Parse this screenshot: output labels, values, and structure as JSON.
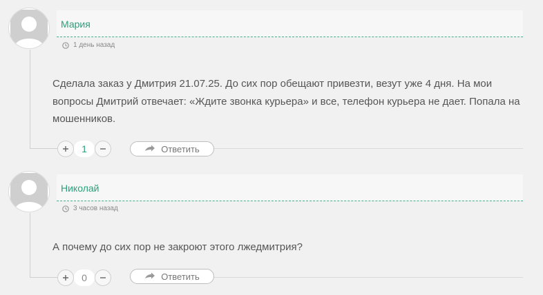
{
  "comments": [
    {
      "author": "Мария",
      "date": "1 день назад",
      "text": "Сделала заказ у Дмитрия 21.07.25. До сих пор обещают привезти, везут уже 4 дня. На мои вопросы Дмитрий отвечает: «Ждите звонка курьера» и все, телефон курьера не дает. Попала на мошенников.",
      "votes": "1",
      "reply_label": "Ответить"
    },
    {
      "author": "Николай",
      "date": "3 часов назад",
      "text": "А почему до сих пор не закроют этого лжедмитрия?",
      "votes": "0",
      "reply_label": "Ответить"
    }
  ],
  "icons": {
    "avatar": "default-avatar-icon",
    "clock": "clock-icon",
    "upvote": "plus-icon",
    "downvote": "minus-icon",
    "reply": "reply-arrow-icon"
  },
  "colors": {
    "author": "#2aa07a",
    "dashed_rule": "#3fae8c",
    "background": "#f1f1f1"
  }
}
